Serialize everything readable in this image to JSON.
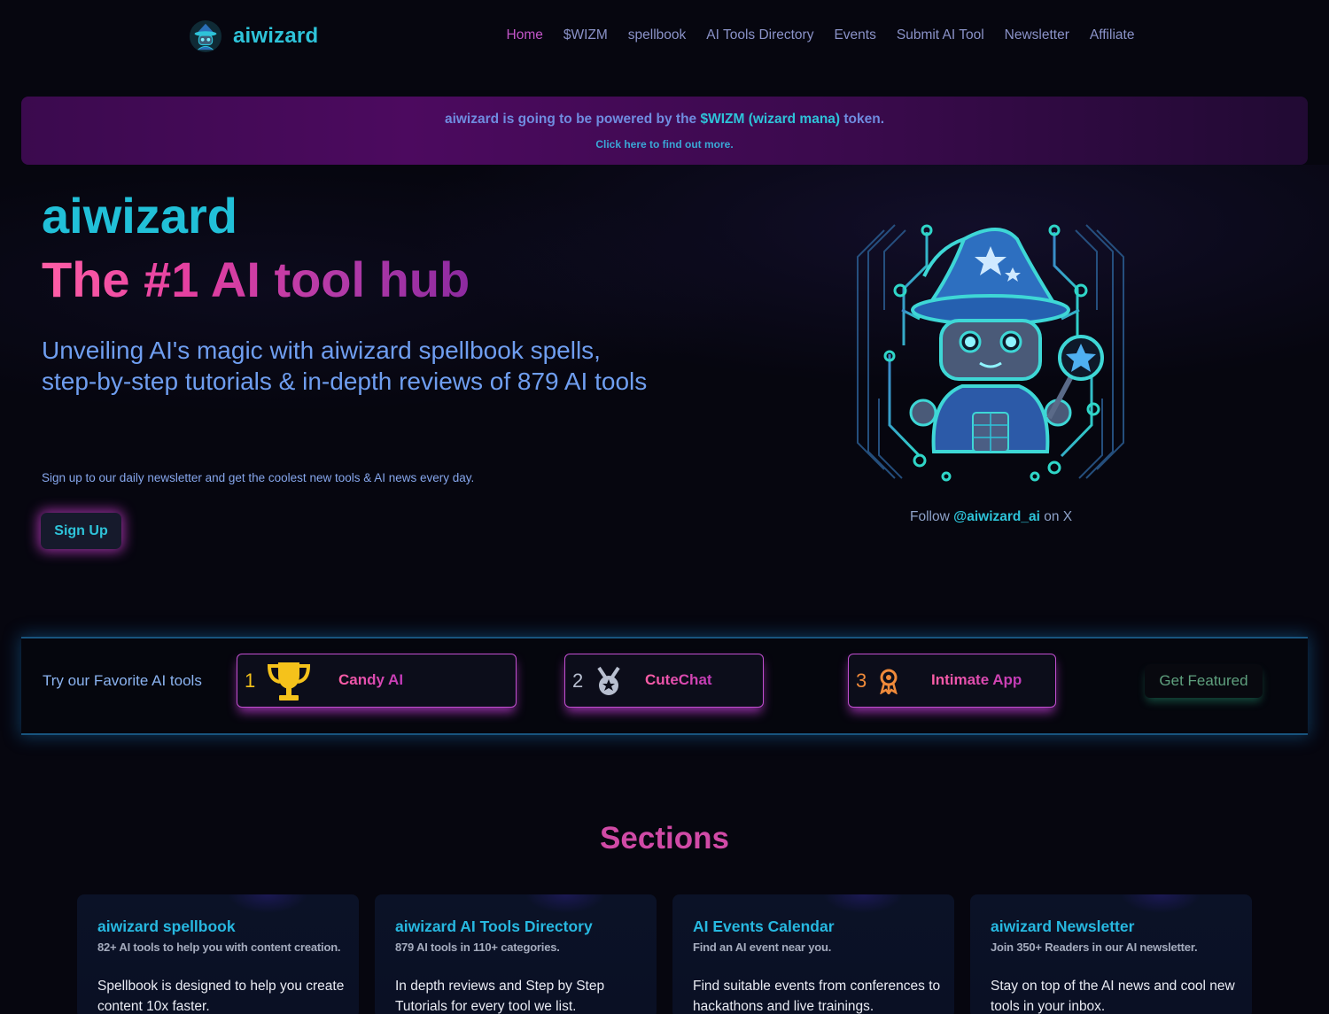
{
  "brand": {
    "name": "aiwizard"
  },
  "nav": {
    "items": [
      {
        "label": "Home",
        "active": true
      },
      {
        "label": "$WIZM",
        "active": false
      },
      {
        "label": "spellbook",
        "active": false
      },
      {
        "label": "AI Tools Directory",
        "active": false
      },
      {
        "label": "Events",
        "active": false
      },
      {
        "label": "Submit AI Tool",
        "active": false
      },
      {
        "label": "Newsletter",
        "active": false
      },
      {
        "label": "Affiliate",
        "active": false
      }
    ]
  },
  "banner": {
    "prefix": "aiwizard is going to be powered by the ",
    "highlight": "$WIZM (wizard mana)",
    "suffix": " token.",
    "link": "Click here to find out more."
  },
  "hero": {
    "title": "aiwizard",
    "subtitle": "The #1 AI tool hub",
    "tagline": "Unveiling AI's magic with aiwizard spellbook spells, step-by-step tutorials & in-depth reviews of 879 AI tools",
    "signup_text": "Sign up to our daily newsletter and get the coolest new tools & AI news every day.",
    "signup_button": "Sign Up",
    "follow_prefix": "Follow ",
    "follow_handle": "@aiwizard_ai",
    "follow_suffix": " on X"
  },
  "favorites": {
    "label": "Try our Favorite AI tools",
    "tools": [
      {
        "rank": "1",
        "name": "Candy AI",
        "icon": "trophy-icon",
        "rank_color": "#f5c21b"
      },
      {
        "rank": "2",
        "name": "CuteChat",
        "icon": "silver-medal-icon",
        "rank_color": "#b8bfd0"
      },
      {
        "rank": "3",
        "name": "Intimate App",
        "icon": "bronze-award-icon",
        "rank_color": "#f08a3a"
      }
    ],
    "get_featured": "Get Featured"
  },
  "sections": {
    "title": "Sections",
    "cards": [
      {
        "title": "aiwizard spellbook",
        "subtitle": "82+ AI tools to help you with content creation.",
        "description": "Spellbook is designed to help you create content 10x faster."
      },
      {
        "title": "aiwizard AI Tools Directory",
        "subtitle": "879 AI tools in 110+ categories.",
        "description": "In depth reviews and Step by Step Tutorials for every tool we list."
      },
      {
        "title": "AI Events Calendar",
        "subtitle": "Find an AI event near you.",
        "description": "Find suitable events from conferences to hackathons and live trainings."
      },
      {
        "title": "aiwizard Newsletter",
        "subtitle": "Join 350+ Readers in our AI newsletter.",
        "description": "Stay on top of the AI news and cool new tools in your inbox."
      }
    ]
  },
  "colors": {
    "accent": "#2ec3d9",
    "magenta": "#c24fd0",
    "background": "#06060f"
  }
}
